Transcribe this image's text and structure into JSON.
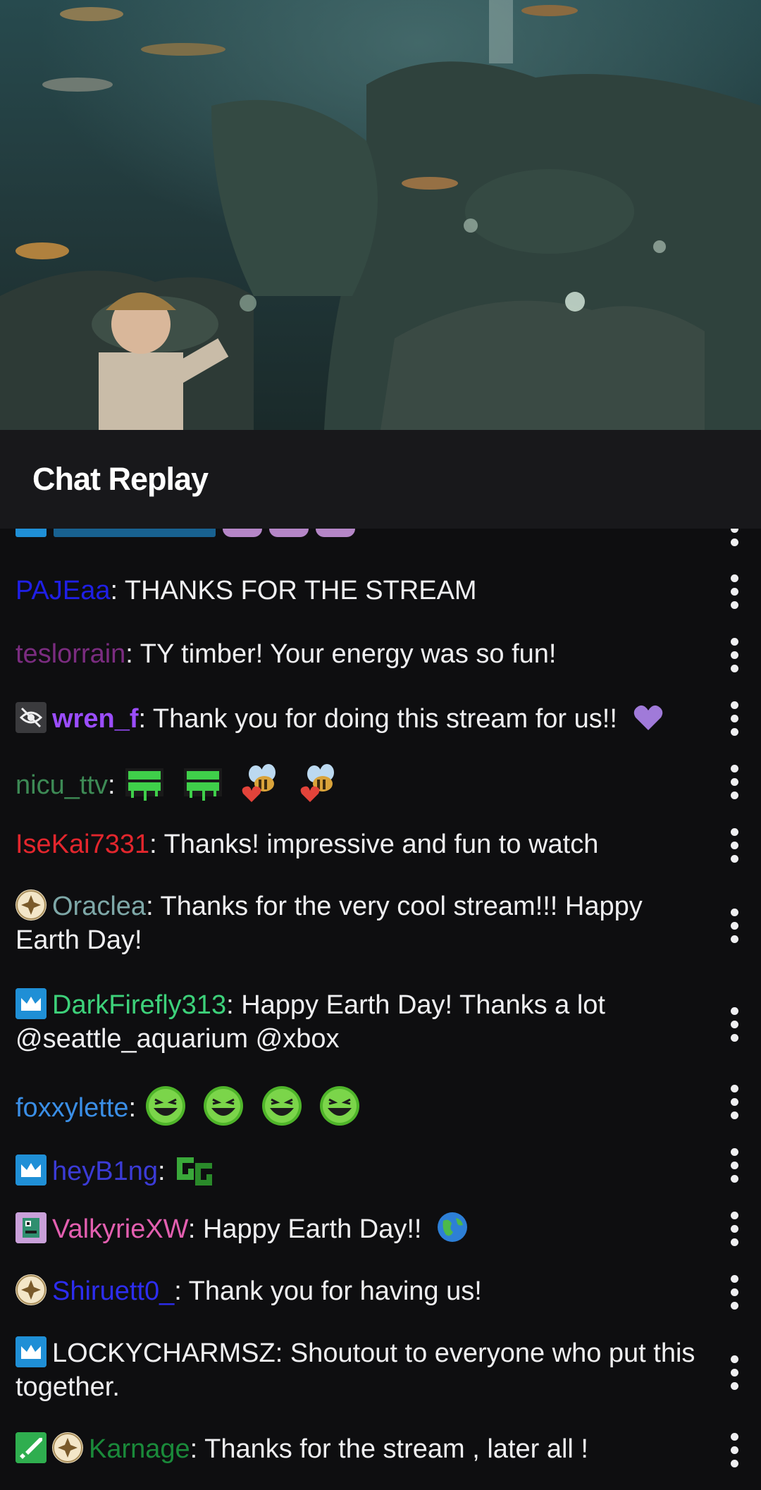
{
  "header": {
    "title": "Chat Replay"
  },
  "colors": {
    "background": "#0e0e10",
    "header_background": "#18181b",
    "text": "#efeff1"
  },
  "messages": [
    {
      "user": "PAJEaa",
      "user_color": "#1f1fe6",
      "badges": [],
      "text": ": THANKS FOR THE STREAM",
      "emotes": []
    },
    {
      "user": "teslorrain",
      "user_color": "#7b2c80",
      "badges": [],
      "text": ": TY timber! Your energy was so fun!",
      "emotes": []
    },
    {
      "user": "wren_f",
      "user_color": "#9b4dff",
      "badges": [
        "eye-slash-badge"
      ],
      "text": ": Thank you for doing this stream for us!!",
      "emotes": [
        "purple-heart-emoji"
      ]
    },
    {
      "user": "nicu_ttv",
      "user_color": "#3d8a55",
      "badges": [],
      "text": ":",
      "emotes": [
        "bleed-green-emote",
        "bleed-green-emote",
        "bee-heart-emote",
        "bee-heart-emote"
      ]
    },
    {
      "user": "IseKai7331",
      "user_color": "#e3262d",
      "badges": [],
      "text": ": Thanks! impressive and fun to watch",
      "emotes": []
    },
    {
      "user": "Oraclea",
      "user_color": "#7ea8a8",
      "badges": [
        "gold-star-badge"
      ],
      "text": ": Thanks for the very cool stream!!! Happy Earth Day!",
      "emotes": []
    },
    {
      "user": "DarkFirefly313",
      "user_color": "#3dd17a",
      "badges": [
        "crown-badge"
      ],
      "text": ": Happy Earth Day! Thanks a lot @seattle_aquarium @xbox",
      "emotes": []
    },
    {
      "user": "foxxylette",
      "user_color": "#3a8ee6",
      "badges": [],
      "text": ":",
      "emotes": [
        "xbox-laugh-emote",
        "xbox-laugh-emote",
        "xbox-laugh-emote",
        "xbox-laugh-emote"
      ]
    },
    {
      "user": "heyB1ng",
      "user_color": "#3b3bd6",
      "badges": [
        "crown-badge"
      ],
      "text": ":",
      "emotes": [
        "gg-emote"
      ]
    },
    {
      "user": "ValkyrieXW",
      "user_color": "#e35fb0",
      "badges": [
        "pixel-badge"
      ],
      "text": ": Happy Earth Day!!",
      "emotes": [
        "globe-emoji"
      ]
    },
    {
      "user": "Shiruett0_",
      "user_color": "#2d2df0",
      "badges": [
        "gold-star-badge"
      ],
      "text": ": Thank you for having us!",
      "emotes": []
    },
    {
      "user": "LOCKYCHARMSZ",
      "user_color": "#efeff1",
      "badges": [
        "crown-badge"
      ],
      "text": ": Shoutout to everyone who put this together.",
      "emotes": []
    },
    {
      "user": "Karnage",
      "user_color": "#1a8a3a",
      "badges": [
        "sword-badge",
        "gold-star-badge"
      ],
      "text": ": Thanks for the stream , later all !",
      "emotes": []
    }
  ]
}
